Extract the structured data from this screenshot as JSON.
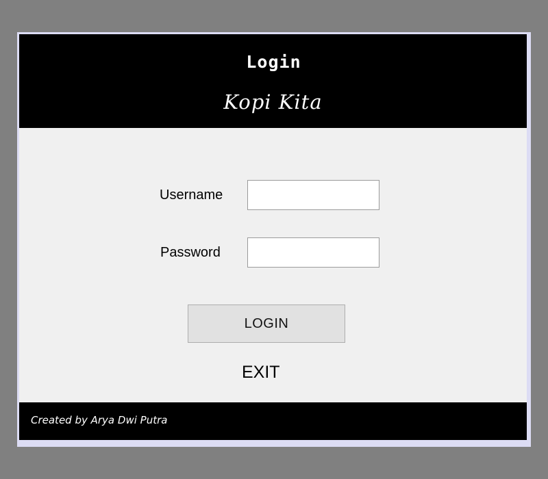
{
  "header": {
    "title": "Login",
    "brand": "Kopi Kita"
  },
  "form": {
    "username_label": "Username",
    "username_value": "",
    "password_label": "Password",
    "password_value": "",
    "login_label": "LOGIN",
    "exit_label": "EXIT"
  },
  "footer": {
    "credit": "Created by Arya Dwi Putra"
  },
  "colors": {
    "background": "#808080",
    "header_bg": "#000000",
    "panel_bg": "#f0f0f0",
    "button_bg": "#e1e1e1",
    "text_light": "#ffffff"
  }
}
